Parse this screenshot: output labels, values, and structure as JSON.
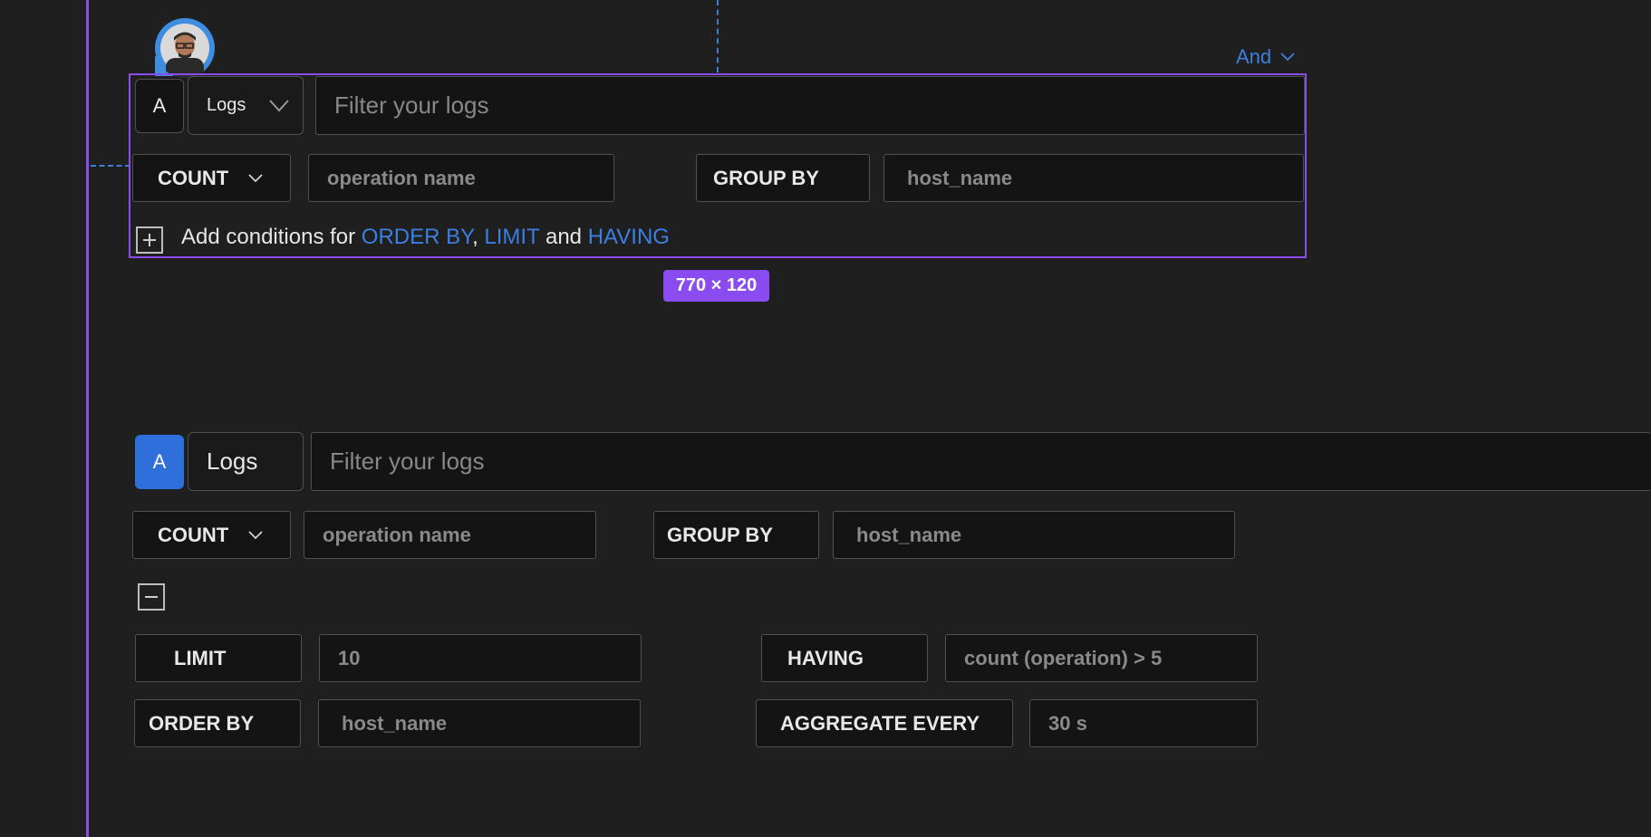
{
  "query_a": {
    "and_dropdown": "And",
    "query_letter": "A",
    "data_source": "Logs",
    "filter_placeholder": "Filter your logs",
    "aggregate_op": "COUNT",
    "aggregate_attr_placeholder": "operation name",
    "group_by_label": "GROUP BY",
    "group_by_placeholder": "host_name",
    "add_conditions_prefix": "Add conditions for",
    "order_by_link": "ORDER BY",
    "comma": ",",
    "limit_link": "LIMIT",
    "and_word": "and",
    "having_link": "HAVING"
  },
  "selection_badge": "770 × 120",
  "query_b": {
    "query_letter": "A",
    "data_source": "Logs",
    "filter_placeholder": "Filter your logs",
    "aggregate_op": "COUNT",
    "aggregate_attr_placeholder": "operation name",
    "group_by_label": "GROUP BY",
    "group_by_placeholder": "host_name",
    "limit_label": "LIMIT",
    "limit_placeholder": "10",
    "having_label": "HAVING",
    "having_placeholder": "count (operation) > 5",
    "order_by_label": "ORDER BY",
    "order_by_placeholder": "host_name",
    "aggregate_every_label": "AGGREGATE EVERY",
    "aggregate_every_placeholder": "30 s"
  },
  "colors": {
    "selection": "#8a4cf0",
    "accent": "#3d7fe0",
    "active_letter": "#2f6fdc",
    "background": "#1f1f1f"
  }
}
